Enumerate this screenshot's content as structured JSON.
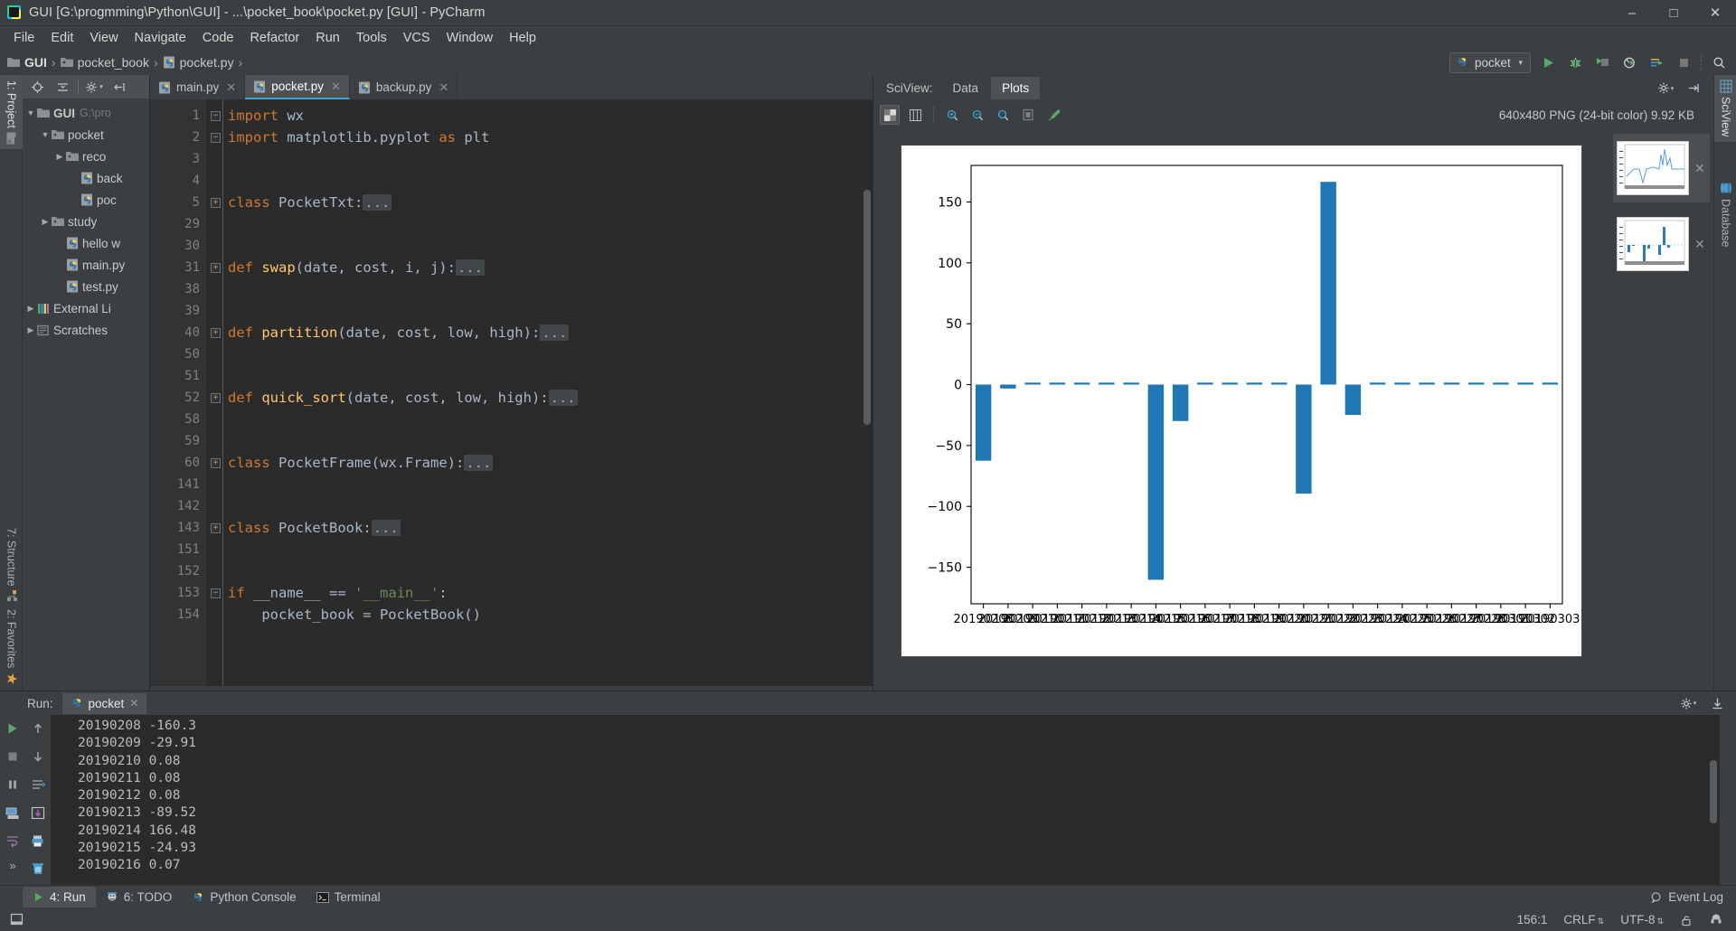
{
  "window": {
    "title": "GUI [G:\\progmming\\Python\\GUI] - ...\\pocket_book\\pocket.py [GUI] - PyCharm",
    "app_icon": "pycharm-logo",
    "minimize": "–",
    "maximize": "□",
    "close": "✕"
  },
  "menubar": [
    {
      "label": "File"
    },
    {
      "label": "Edit"
    },
    {
      "label": "View"
    },
    {
      "label": "Navigate"
    },
    {
      "label": "Code"
    },
    {
      "label": "Refactor"
    },
    {
      "label": "Run"
    },
    {
      "label": "Tools"
    },
    {
      "label": "VCS"
    },
    {
      "label": "Window"
    },
    {
      "label": "Help"
    }
  ],
  "navbar": {
    "crumbs": [
      {
        "label": "GUI",
        "icon": "folder-icon"
      },
      {
        "label": "pocket_book",
        "icon": "folder-icon"
      },
      {
        "label": "pocket.py",
        "icon": "python-file-icon"
      }
    ],
    "separator": "›",
    "run_config": "pocket",
    "run_config_chevron": "▾",
    "buttons": [
      {
        "name": "run-button",
        "glyph": "▶"
      },
      {
        "name": "debug-button",
        "glyph": "⚙"
      },
      {
        "name": "run-coverage-button",
        "glyph": "▶"
      },
      {
        "name": "profile-button",
        "glyph": "◔"
      },
      {
        "name": "run-with-console-button",
        "glyph": "☰"
      },
      {
        "name": "stop-button",
        "glyph": "■"
      },
      {
        "name": "search-everywhere-button",
        "glyph": "⌕"
      }
    ]
  },
  "left_tool_strip": [
    {
      "label": "1: Project",
      "accel": "1",
      "icon": "project-icon",
      "active": true
    },
    {
      "label": "7: Structure",
      "accel": "7",
      "icon": "structure-icon",
      "active": false
    },
    {
      "label": "2: Favorites",
      "accel": "2",
      "icon": "star-icon",
      "active": false
    }
  ],
  "project_panel": {
    "toolbar": [
      {
        "name": "locate-icon",
        "glyph": "⊕"
      },
      {
        "name": "collapse-all-icon",
        "glyph": "≡"
      },
      {
        "name": "settings-gear-icon",
        "glyph": "⚙"
      },
      {
        "name": "hide-panel-icon",
        "glyph": "⇤"
      }
    ],
    "tree": [
      {
        "depth": 0,
        "arrow": "▼",
        "icon": "folder-icon",
        "label": "GUI",
        "sub": "G:\\pro",
        "bold": true
      },
      {
        "depth": 1,
        "arrow": "▼",
        "icon": "folder-icon",
        "label": "pocket",
        "sub": "",
        "bold": false
      },
      {
        "depth": 2,
        "arrow": "▶",
        "icon": "folder-icon",
        "label": "reco",
        "sub": "",
        "bold": false
      },
      {
        "depth": 3,
        "arrow": "",
        "icon": "python-file-icon",
        "label": "back",
        "sub": "",
        "bold": false
      },
      {
        "depth": 3,
        "arrow": "",
        "icon": "python-file-icon",
        "label": "poc",
        "sub": "",
        "bold": false
      },
      {
        "depth": 1,
        "arrow": "▶",
        "icon": "folder-icon",
        "label": "study",
        "sub": "",
        "bold": false
      },
      {
        "depth": 2,
        "arrow": "",
        "icon": "python-file-icon",
        "label": "hello w",
        "sub": "",
        "bold": false
      },
      {
        "depth": 2,
        "arrow": "",
        "icon": "python-file-icon",
        "label": "main.py",
        "sub": "",
        "bold": false
      },
      {
        "depth": 2,
        "arrow": "",
        "icon": "python-file-icon",
        "label": "test.py",
        "sub": "",
        "bold": false
      },
      {
        "depth": 0,
        "arrow": "▶",
        "icon": "library-icon",
        "label": "External Li",
        "sub": "",
        "bold": false
      },
      {
        "depth": 0,
        "arrow": "▶",
        "icon": "scratches-icon",
        "label": "Scratches",
        "sub": "",
        "bold": false
      }
    ]
  },
  "editor": {
    "tabs": [
      {
        "label": "main.py",
        "icon": "python-file-icon",
        "active": false,
        "close": "✕"
      },
      {
        "label": "pocket.py",
        "icon": "python-file-icon",
        "active": true,
        "close": "✕"
      },
      {
        "label": "backup.py",
        "icon": "python-file-icon",
        "active": false,
        "close": "✕"
      }
    ],
    "lines": [
      {
        "num": "1",
        "fold": "⊖",
        "html": "<span class='kw'>import</span> <span class='pl'>wx</span>",
        "run": false
      },
      {
        "num": "2",
        "fold": "⊖",
        "html": "<span class='kw'>import</span> <span class='pl'>matplotlib.pyplot</span> <span class='kw'>as</span> <span class='pl'>plt</span>",
        "run": false
      },
      {
        "num": "3",
        "fold": "",
        "html": "",
        "run": false
      },
      {
        "num": "4",
        "fold": "",
        "html": "",
        "run": false
      },
      {
        "num": "5",
        "fold": "⊕",
        "html": "<span class='kw'>class</span> <span class='cls'>PocketTxt</span><span class='pl'>:</span><span class='dots'>...</span>",
        "run": false
      },
      {
        "num": "29",
        "fold": "",
        "html": "",
        "run": false
      },
      {
        "num": "30",
        "fold": "",
        "html": "",
        "run": false
      },
      {
        "num": "31",
        "fold": "⊕",
        "html": "<span class='kw'>def</span> <span class='fn'>swap</span><span class='pl'>(date, cost, i, j):</span><span class='dots'>...</span>",
        "run": false
      },
      {
        "num": "38",
        "fold": "",
        "html": "",
        "run": false
      },
      {
        "num": "39",
        "fold": "",
        "html": "",
        "run": false
      },
      {
        "num": "40",
        "fold": "⊕",
        "html": "<span class='kw'>def</span> <span class='fn'>partition</span><span class='pl'>(date, cost, low, high):</span><span class='dots'>...</span>",
        "run": false
      },
      {
        "num": "50",
        "fold": "",
        "html": "",
        "run": false
      },
      {
        "num": "51",
        "fold": "",
        "html": "",
        "run": false
      },
      {
        "num": "52",
        "fold": "⊕",
        "html": "<span class='kw'>def</span> <span class='fn'>quick_sort</span><span class='pl'>(date, cost, low, high):</span><span class='dots'>...</span>",
        "run": false
      },
      {
        "num": "58",
        "fold": "",
        "html": "",
        "run": false
      },
      {
        "num": "59",
        "fold": "",
        "html": "",
        "run": false
      },
      {
        "num": "60",
        "fold": "⊕",
        "html": "<span class='kw'>class</span> <span class='cls'>PocketFrame</span><span class='pl'>(wx.Frame):</span><span class='dots'>...</span>",
        "run": false
      },
      {
        "num": "141",
        "fold": "",
        "html": "",
        "run": false
      },
      {
        "num": "142",
        "fold": "",
        "html": "",
        "run": false
      },
      {
        "num": "143",
        "fold": "⊕",
        "html": "<span class='kw'>class</span> <span class='cls'>PocketBook</span><span class='pl'>:</span><span class='dots'>...</span>",
        "run": false
      },
      {
        "num": "151",
        "fold": "",
        "html": "",
        "run": false
      },
      {
        "num": "152",
        "fold": "",
        "html": "",
        "run": false
      },
      {
        "num": "153",
        "fold": "⊖",
        "html": "<span class='kw'>if</span> <span class='pl'>__name__</span> <span class='pl'>==</span> <span class='str'>'__main__'</span><span class='pl'>:</span>",
        "run": true
      },
      {
        "num": "154",
        "fold": "",
        "html": "    <span class='pl'>pocket_book = PocketBook()</span>",
        "run": false
      }
    ]
  },
  "sciview": {
    "label": "SciView:",
    "tabs": [
      {
        "label": "Data",
        "active": false
      },
      {
        "label": "Plots",
        "active": true
      }
    ],
    "header_buttons": [
      {
        "name": "settings-gear-icon",
        "glyph": "⚙"
      },
      {
        "name": "hide-panel-icon",
        "glyph": "→|"
      }
    ],
    "toolbar": [
      {
        "name": "transparency-grid-icon",
        "glyph": "▨",
        "active": true
      },
      {
        "name": "grid-icon",
        "glyph": "☷",
        "active": false
      },
      {
        "name": "zoom-in-icon",
        "glyph": "⊕",
        "active": false
      },
      {
        "name": "zoom-out-icon",
        "glyph": "⊖",
        "active": false
      },
      {
        "name": "zoom-actual-icon",
        "glyph": "⊙",
        "active": false
      },
      {
        "name": "fit-icon",
        "glyph": "⛶",
        "active": false
      },
      {
        "name": "color-picker-icon",
        "glyph": "✒",
        "active": false
      }
    ],
    "image_info": "640x480 PNG (24-bit color) 9.92 KB",
    "thumbnails": [
      {
        "name": "plot-thumbnail-line",
        "type": "line",
        "active": true,
        "close": "✕"
      },
      {
        "name": "plot-thumbnail-bar",
        "type": "bar",
        "active": false,
        "close": "✕"
      }
    ],
    "right_strip": [
      {
        "label": "SciView",
        "icon": "table-icon",
        "active": true
      },
      {
        "label": "Database",
        "icon": "database-icon",
        "active": false
      }
    ]
  },
  "chart_data": {
    "type": "bar",
    "title": "",
    "xlabel": "",
    "ylabel": "",
    "grid": false,
    "legend": null,
    "bar_color": "#1f77b4",
    "ylim": [
      -180,
      180
    ],
    "yticks": [
      150,
      100,
      50,
      0,
      -50,
      -100,
      -150
    ],
    "ytick_labels": [
      "150",
      "100",
      "50",
      "0",
      "−50",
      "−100",
      "−150"
    ],
    "categories": [
      "20190208",
      "20190209",
      "20190210",
      "20190211",
      "20190212",
      "20190213",
      "20190214",
      "20190215",
      "20190216",
      "20190217",
      "20190218",
      "20190219",
      "20190220",
      "20190221",
      "20190222",
      "20190223",
      "20190224",
      "20190225",
      "20190226",
      "20190227",
      "20190228",
      "20190301",
      "20190302",
      "20190303"
    ],
    "values": [
      -62.5,
      -3.2,
      0.08,
      0.08,
      0.08,
      0.08,
      0.08,
      -160.3,
      -29.91,
      0.08,
      0.08,
      0.08,
      0.08,
      -89.52,
      166.48,
      -24.93,
      0.07,
      0.08,
      0.08,
      0.08,
      0.08,
      0.08,
      0.08,
      0.08
    ]
  },
  "run_panel": {
    "label": "Run:",
    "tab": {
      "label": "pocket",
      "icon": "python-file-icon",
      "close": "✕"
    },
    "header_buttons": [
      {
        "name": "settings-gear-icon",
        "glyph": "⚙"
      },
      {
        "name": "export-icon",
        "glyph": "↧"
      }
    ],
    "sidebar": [
      {
        "name": "rerun-button",
        "glyph": "▶"
      },
      {
        "name": "stop-button",
        "glyph": "■"
      },
      {
        "name": "pause-button",
        "glyph": "‖"
      },
      {
        "name": "console-button",
        "glyph": "⌸"
      },
      {
        "name": "soft-wrap-button",
        "glyph": "↩"
      },
      {
        "name": "more-button",
        "glyph": "»"
      }
    ],
    "sidebar2": [
      {
        "name": "up-stacktrace-button",
        "glyph": "↑"
      },
      {
        "name": "down-stacktrace-button",
        "glyph": "↓"
      },
      {
        "name": "soft-wrap-toggle-button",
        "glyph": "⇄"
      },
      {
        "name": "scroll-to-end-button",
        "glyph": "⤓"
      },
      {
        "name": "print-button",
        "glyph": "⎙"
      },
      {
        "name": "clear-all-button",
        "glyph": "🗑"
      }
    ],
    "console_lines": [
      "20190208 -160.3",
      "20190209 -29.91",
      "20190210 0.08",
      "20190211 0.08",
      "20190212 0.08",
      "20190213 -89.52",
      "20190214 166.48",
      "20190215 -24.93",
      "20190216 0.07"
    ]
  },
  "bottom_bar": {
    "items": [
      {
        "label": "4: Run",
        "accel": "4",
        "icon": "run-icon",
        "active": true
      },
      {
        "label": "6: TODO",
        "accel": "6",
        "icon": "todo-icon",
        "active": false
      },
      {
        "label": "Python Console",
        "accel": "",
        "icon": "python-file-icon",
        "active": false
      },
      {
        "label": "Terminal",
        "accel": "",
        "icon": "terminal-icon",
        "active": false
      }
    ],
    "event_log": "Event Log",
    "event_log_icon": "magnifier-icon"
  },
  "statusbar": {
    "left_icon": "toggle-toolwindows-icon",
    "caret": "156:1",
    "line_separator": "CRLF",
    "encoding": "UTF-8",
    "lock_icon": "lock-icon",
    "inspection_icon": "inspector-icon",
    "stepper": "↕"
  }
}
